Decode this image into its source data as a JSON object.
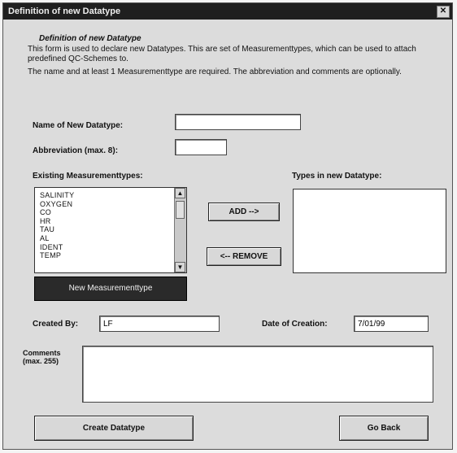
{
  "window": {
    "title": "Definition of new Datatype",
    "close_glyph": "✕"
  },
  "intro": {
    "heading": "Definition of new Datatype",
    "paragraph1": "This form is used to declare new Datatypes. This are set of Measurementtypes, which can be used to attach predefined QC-Schemes to.",
    "paragraph2": "The name and at least 1 Measurementtype are required. The abbreviation and comments are optionally."
  },
  "fields": {
    "name_label": "Name of New Datatype:",
    "name_value": "",
    "abbreviation_label": "Abbreviation (max. 8):",
    "abbreviation_value": ""
  },
  "existing": {
    "label": "Existing Measurementtypes:",
    "items": [
      "SALINITY",
      "OXYGEN",
      "CO",
      "HR",
      "TAU",
      "AL",
      "IDENT",
      "TEMP"
    ],
    "new_button": "New Measurementtype"
  },
  "target": {
    "label": "Types in new Datatype:",
    "items": []
  },
  "buttons": {
    "add": "ADD -->",
    "remove": "<-- REMOVE",
    "create": "Create Datatype",
    "goback": "Go Back"
  },
  "meta": {
    "created_by_label": "Created By:",
    "created_by_value": "LF",
    "date_label": "Date of Creation:",
    "date_value": "7/01/99",
    "comments_label": "Comments (max. 255)",
    "comments_value": ""
  },
  "icons": {
    "scroll_up": "scroll-up-icon",
    "scroll_down": "scroll-down-icon",
    "close": "close-icon"
  }
}
